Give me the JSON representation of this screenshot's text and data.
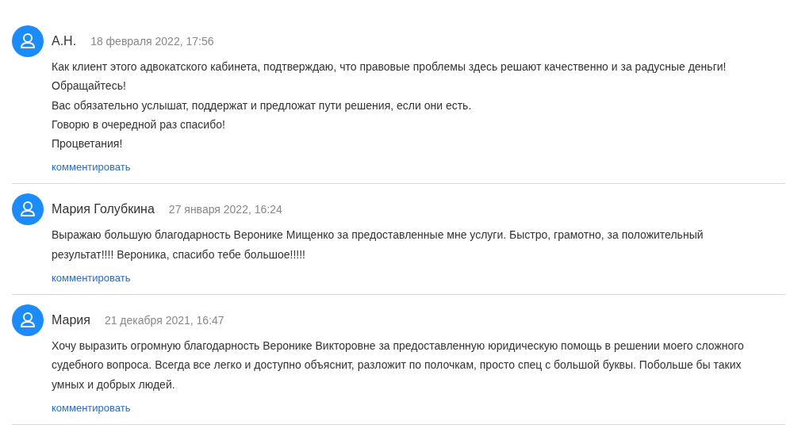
{
  "comments": [
    {
      "author": "А.Н.",
      "date": "18 февраля 2022, 17:56",
      "paragraphs": [
        "Как клиент этого адвокатского кабинета, подтверждаю, что правовые проблемы здесь решают качественно и за радусные деньги!",
        "Обращайтесь!",
        "Вас обязательно услышат, поддержат и предложат пути решения, если они есть.",
        "Говорю в очередной раз спасибо!",
        "Процветания!"
      ],
      "reply_link": "комментировать"
    },
    {
      "author": "Мария Голубкина",
      "date": "27 января 2022, 16:24",
      "paragraphs": [
        "Выражаю большую благодарность Веронике Мищенко за предоставленные мне услуги. Быстро, грамотно, за положительный результат!!!! Вероника, спасибо тебе большое!!!!!"
      ],
      "reply_link": "комментировать"
    },
    {
      "author": "Мария",
      "date": "21 декабря 2021, 16:47",
      "paragraphs": [
        "Хочу выразить огромную благодарность Веронике Викторовне за предоставленную юридическую помощь в решении моего сложного судебного вопроса. Всегда все легко и доступно объяснит, разложит по полочкам, просто спец с большой буквы. Побольше бы таких умных и добрых людей."
      ],
      "reply_link": "комментировать"
    }
  ]
}
